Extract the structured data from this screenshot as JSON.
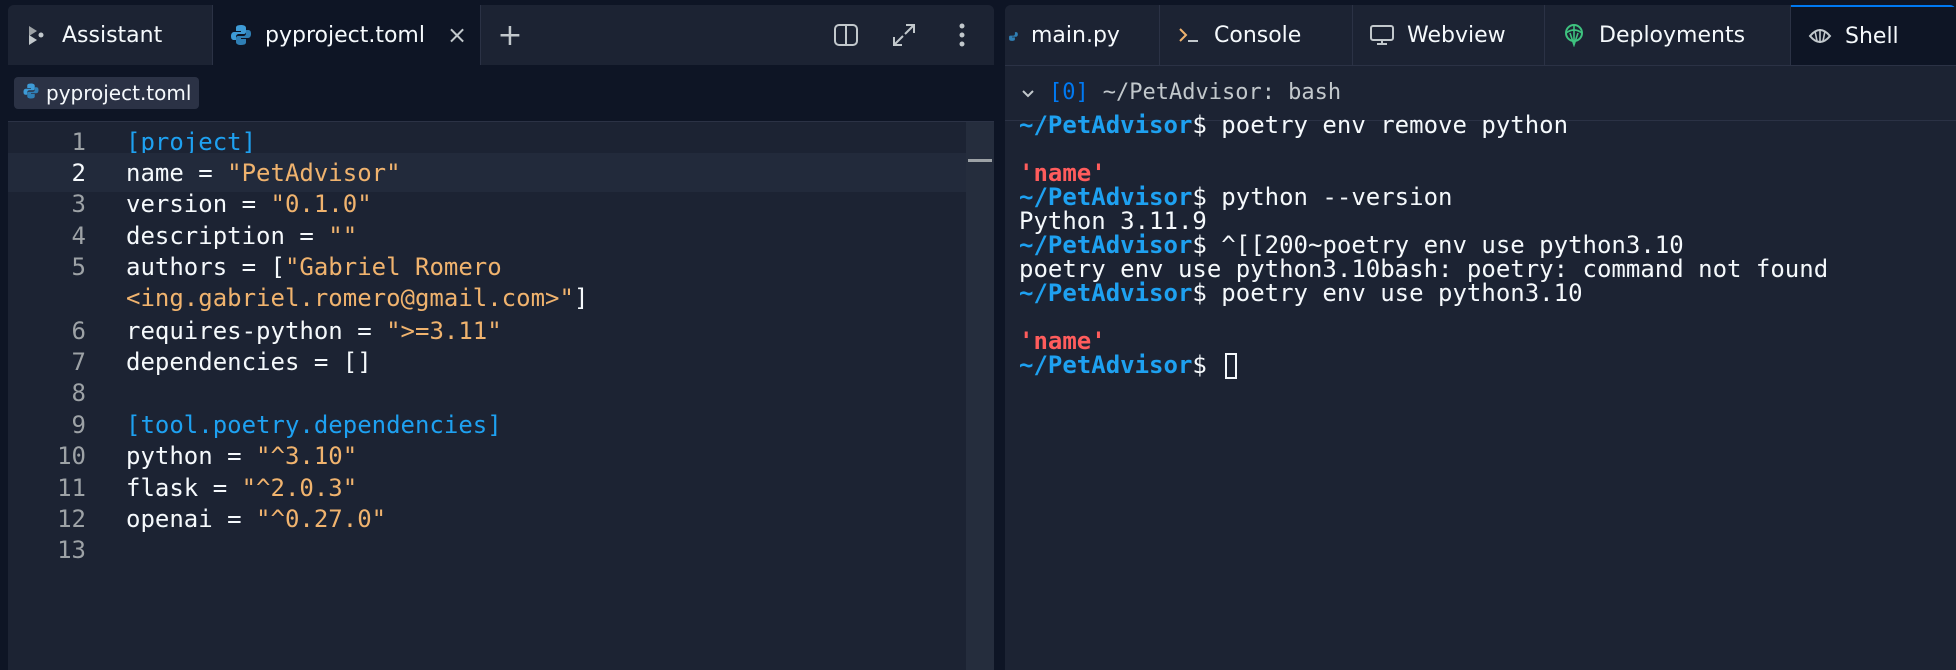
{
  "left": {
    "tabs": [
      {
        "label": "Assistant",
        "icon": "assistant-icon"
      },
      {
        "label": "pyproject.toml",
        "icon": "python-icon",
        "close": "×"
      }
    ],
    "add_tab": "+",
    "breadcrumb": "pyproject.toml",
    "editor": {
      "lines": [
        {
          "n": "1",
          "parts": [
            [
              "t",
              "[project]"
            ]
          ]
        },
        {
          "n": "2",
          "parts": [
            [
              "k",
              "name = "
            ],
            [
              "s",
              "\"PetAdvisor\""
            ]
          ]
        },
        {
          "n": "3",
          "parts": [
            [
              "k",
              "version = "
            ],
            [
              "s",
              "\"0.1.0\""
            ]
          ]
        },
        {
          "n": "4",
          "parts": [
            [
              "k",
              "description = "
            ],
            [
              "s",
              "\"\""
            ]
          ]
        },
        {
          "n": "5",
          "parts": [
            [
              "k",
              "authors = ["
            ],
            [
              "s",
              "\"Gabriel Romero"
            ]
          ]
        },
        {
          "n": "",
          "parts": [
            [
              "s",
              "<ing.gabriel.romero@gmail.com>\""
            ],
            [
              "k",
              "]"
            ]
          ]
        },
        {
          "n": "6",
          "parts": [
            [
              "k",
              "requires-python = "
            ],
            [
              "s",
              "\">=3.11\""
            ]
          ]
        },
        {
          "n": "7",
          "parts": [
            [
              "k",
              "dependencies = []"
            ]
          ]
        },
        {
          "n": "8",
          "parts": []
        },
        {
          "n": "9",
          "parts": [
            [
              "t",
              "[tool.poetry.dependencies]"
            ]
          ]
        },
        {
          "n": "10",
          "parts": [
            [
              "k",
              "python = "
            ],
            [
              "s",
              "\"^3.10\""
            ]
          ]
        },
        {
          "n": "11",
          "parts": [
            [
              "k",
              "flask = "
            ],
            [
              "s",
              "\"^2.0.3\""
            ]
          ]
        },
        {
          "n": "12",
          "parts": [
            [
              "k",
              "openai = "
            ],
            [
              "s",
              "\"^0.27.0\""
            ]
          ]
        },
        {
          "n": "13",
          "parts": []
        }
      ],
      "active_line": 1
    }
  },
  "right": {
    "tabs": [
      {
        "label": "main.py"
      },
      {
        "label": "Console",
        "icon": "console-icon"
      },
      {
        "label": "Webview",
        "icon": "monitor-icon"
      },
      {
        "label": "Deployments",
        "icon": "deployments-icon"
      },
      {
        "label": "Shell",
        "icon": "shell-icon"
      }
    ],
    "shell_header": {
      "index": "[0]",
      "title": "~/PetAdvisor: bash"
    },
    "terminal": [
      {
        "prompt": "~/PetAdvisor",
        "cmd": "$ poetry env remove python"
      },
      {
        "text": ""
      },
      {
        "error": "'name'"
      },
      {
        "prompt": "~/PetAdvisor",
        "cmd": "$ python --version"
      },
      {
        "text": "Python 3.11.9"
      },
      {
        "prompt": "~/PetAdvisor",
        "cmd": "$ ^[[200~poetry env use python3.10"
      },
      {
        "text": "poetry env use python3.10bash: poetry: command not found"
      },
      {
        "prompt": "~/PetAdvisor",
        "cmd": "$ poetry env use python3.10"
      },
      {
        "text": ""
      },
      {
        "error": "'name'"
      },
      {
        "prompt": "~/PetAdvisor",
        "cmd": "$ ",
        "cursor": true
      }
    ]
  },
  "colors": {
    "background": "#0e1525",
    "pane": "#1c2333",
    "accent_blue": "#1ea1f1",
    "string_orange": "#f0b36e",
    "error_red": "#ff5c5c"
  }
}
